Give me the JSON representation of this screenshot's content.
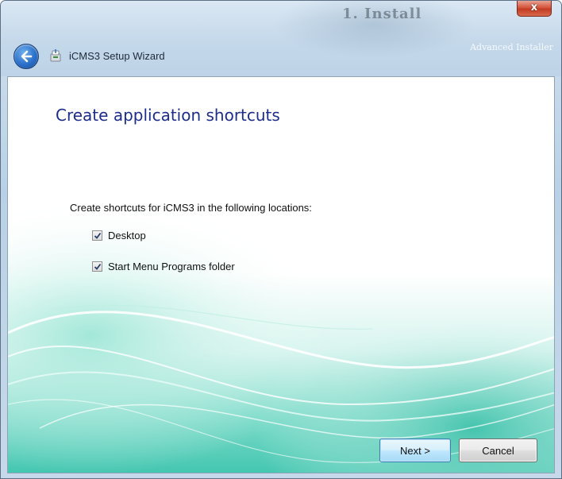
{
  "window": {
    "title": "iCMS3 Setup Wizard",
    "close_label": "x",
    "background_text": "1. Install",
    "brand_text": "Advanced Installer"
  },
  "page": {
    "title": "Create application shortcuts",
    "instruction": "Create shortcuts for iCMS3 in the following locations:"
  },
  "options": [
    {
      "label": "Desktop",
      "checked": true
    },
    {
      "label": "Start Menu Programs folder",
      "checked": true
    }
  ],
  "buttons": {
    "next_label": "Next >",
    "cancel_label": "Cancel"
  },
  "colors": {
    "title_text": "#1d2d8a",
    "wave_teal": "#4fd1b8",
    "wave_light": "#c9f1e8"
  },
  "icons": {
    "back": "back-arrow-icon",
    "app": "installer-icon",
    "check": "checkmark-icon"
  }
}
